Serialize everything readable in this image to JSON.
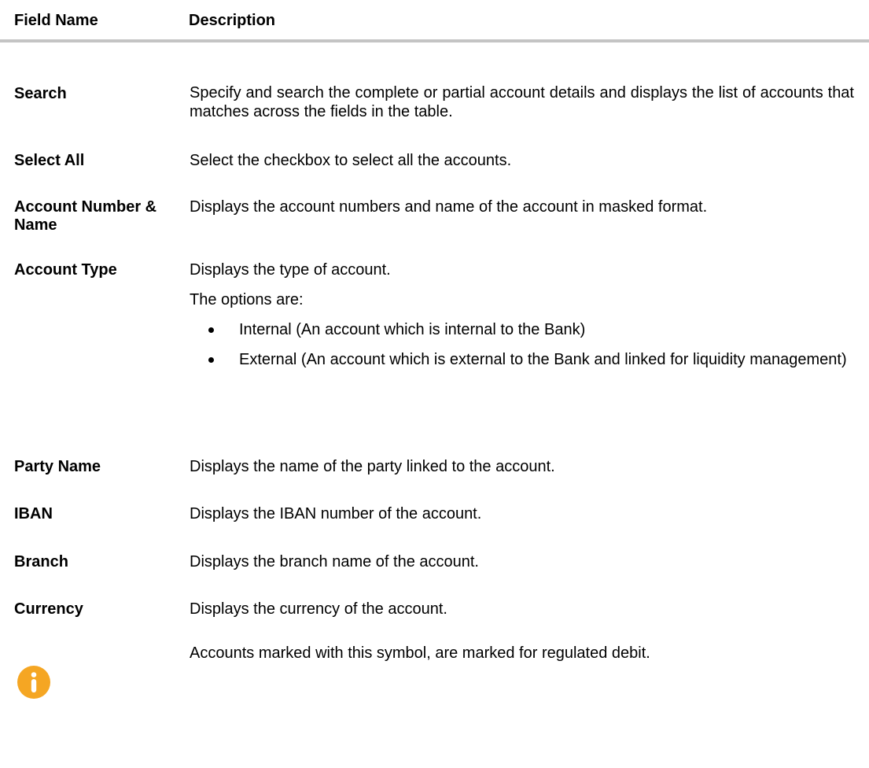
{
  "table": {
    "header": {
      "field_name": "Field Name",
      "description": "Description"
    },
    "rows": [
      {
        "field": "Search",
        "description": "Specify and search the complete or partial account details and displays the list of accounts that matches across the fields in the table."
      },
      {
        "field": "Select All",
        "description": "Select the checkbox to select all the accounts."
      },
      {
        "field": "Account Number & Name",
        "description": "Displays the account numbers and name of the account in masked format."
      },
      {
        "field": "Account Type",
        "description": "Displays the type of account.",
        "options_label": "The options are:",
        "options": [
          "Internal (An account which is internal to the Bank)",
          "External (An account which is external to the Bank and linked for liquidity management)"
        ]
      },
      {
        "field": "Party Name",
        "description": "Displays the name of the party linked to the account."
      },
      {
        "field": "IBAN",
        "description": "Displays the IBAN number of the account."
      },
      {
        "field": "Branch",
        "description": "Displays the branch name of the account."
      },
      {
        "field": "Currency",
        "description": "Displays the currency of the account."
      }
    ],
    "info_row": {
      "icon": "info-icon",
      "description": "Accounts marked with this symbol, are marked for regulated debit."
    }
  },
  "colors": {
    "info_icon": "#F5A623",
    "header_rule": "#C4C4C4"
  }
}
